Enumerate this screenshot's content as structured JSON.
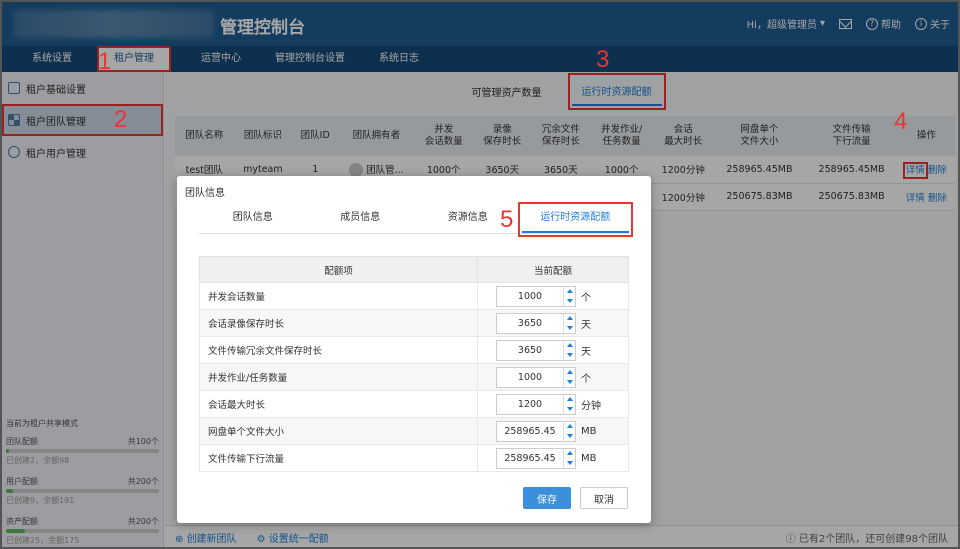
{
  "header": {
    "title": "管理控制台",
    "user": "Hi，超级管理员",
    "help": "帮助",
    "about": "关于"
  },
  "nav": [
    "系统设置",
    "租户管理",
    "运营中心",
    "管理控制台设置",
    "系统日志"
  ],
  "sidebar": {
    "items": [
      "租户基础设置",
      "租户团队管理",
      "租户用户管理"
    ],
    "mode": "当前为租户共享模式",
    "quotas": [
      {
        "label": "团队配额",
        "total": "共100个",
        "sub": "已创建2，余额98",
        "fill": 0.02
      },
      {
        "label": "用户配额",
        "total": "共200个",
        "sub": "已创建9，余额191",
        "fill": 0.045
      },
      {
        "label": "资产配额",
        "total": "共200个",
        "sub": "已创建25，余额175",
        "fill": 0.125
      }
    ]
  },
  "subtabs": [
    "可管理资产数量",
    "运行时资源配额"
  ],
  "table": {
    "headers": [
      "团队名称",
      "团队标识",
      "团队ID",
      "团队拥有者",
      "并发\n会话数量",
      "录像\n保存时长",
      "冗余文件\n保存时长",
      "并发作业/\n任务数量",
      "会话\n最大时长",
      "网盘单个\n文件大小",
      "文件传输\n下行流量",
      "操作"
    ],
    "rows": [
      [
        "test团队",
        "myteam",
        "1",
        "团队管...",
        "1000个",
        "3650天",
        "3650天",
        "1000个",
        "1200分钟",
        "258965.45MB",
        "258965.45MB"
      ],
      [
        "",
        "",
        "",
        "",
        "",
        "",
        "",
        "",
        "1200分钟",
        "250675.83MB",
        "250675.83MB"
      ]
    ],
    "detail": "详情",
    "delete": "删除"
  },
  "footer": {
    "create": "创建新团队",
    "set_quota": "设置统一配额",
    "info": "已有2个团队，还可创建98个团队"
  },
  "modal": {
    "title": "团队信息",
    "tabs": [
      "团队信息",
      "成员信息",
      "资源信息",
      "运行时资源配额"
    ],
    "col_item": "配额项",
    "col_value": "当前配额",
    "rows": [
      {
        "name": "并发会话数量",
        "value": "1000",
        "unit": "个"
      },
      {
        "name": "会话录像保存时长",
        "value": "3650",
        "unit": "天"
      },
      {
        "name": "文件传输冗余文件保存时长",
        "value": "3650",
        "unit": "天"
      },
      {
        "name": "并发作业/任务数量",
        "value": "1000",
        "unit": "个"
      },
      {
        "name": "会话最大时长",
        "value": "1200",
        "unit": "分钟"
      },
      {
        "name": "网盘单个文件大小",
        "value": "258965.45",
        "unit": "MB"
      },
      {
        "name": "文件传输下行流量",
        "value": "258965.45",
        "unit": "MB"
      }
    ],
    "save": "保存",
    "cancel": "取消"
  },
  "markers": [
    "1",
    "2",
    "3",
    "4",
    "5"
  ]
}
